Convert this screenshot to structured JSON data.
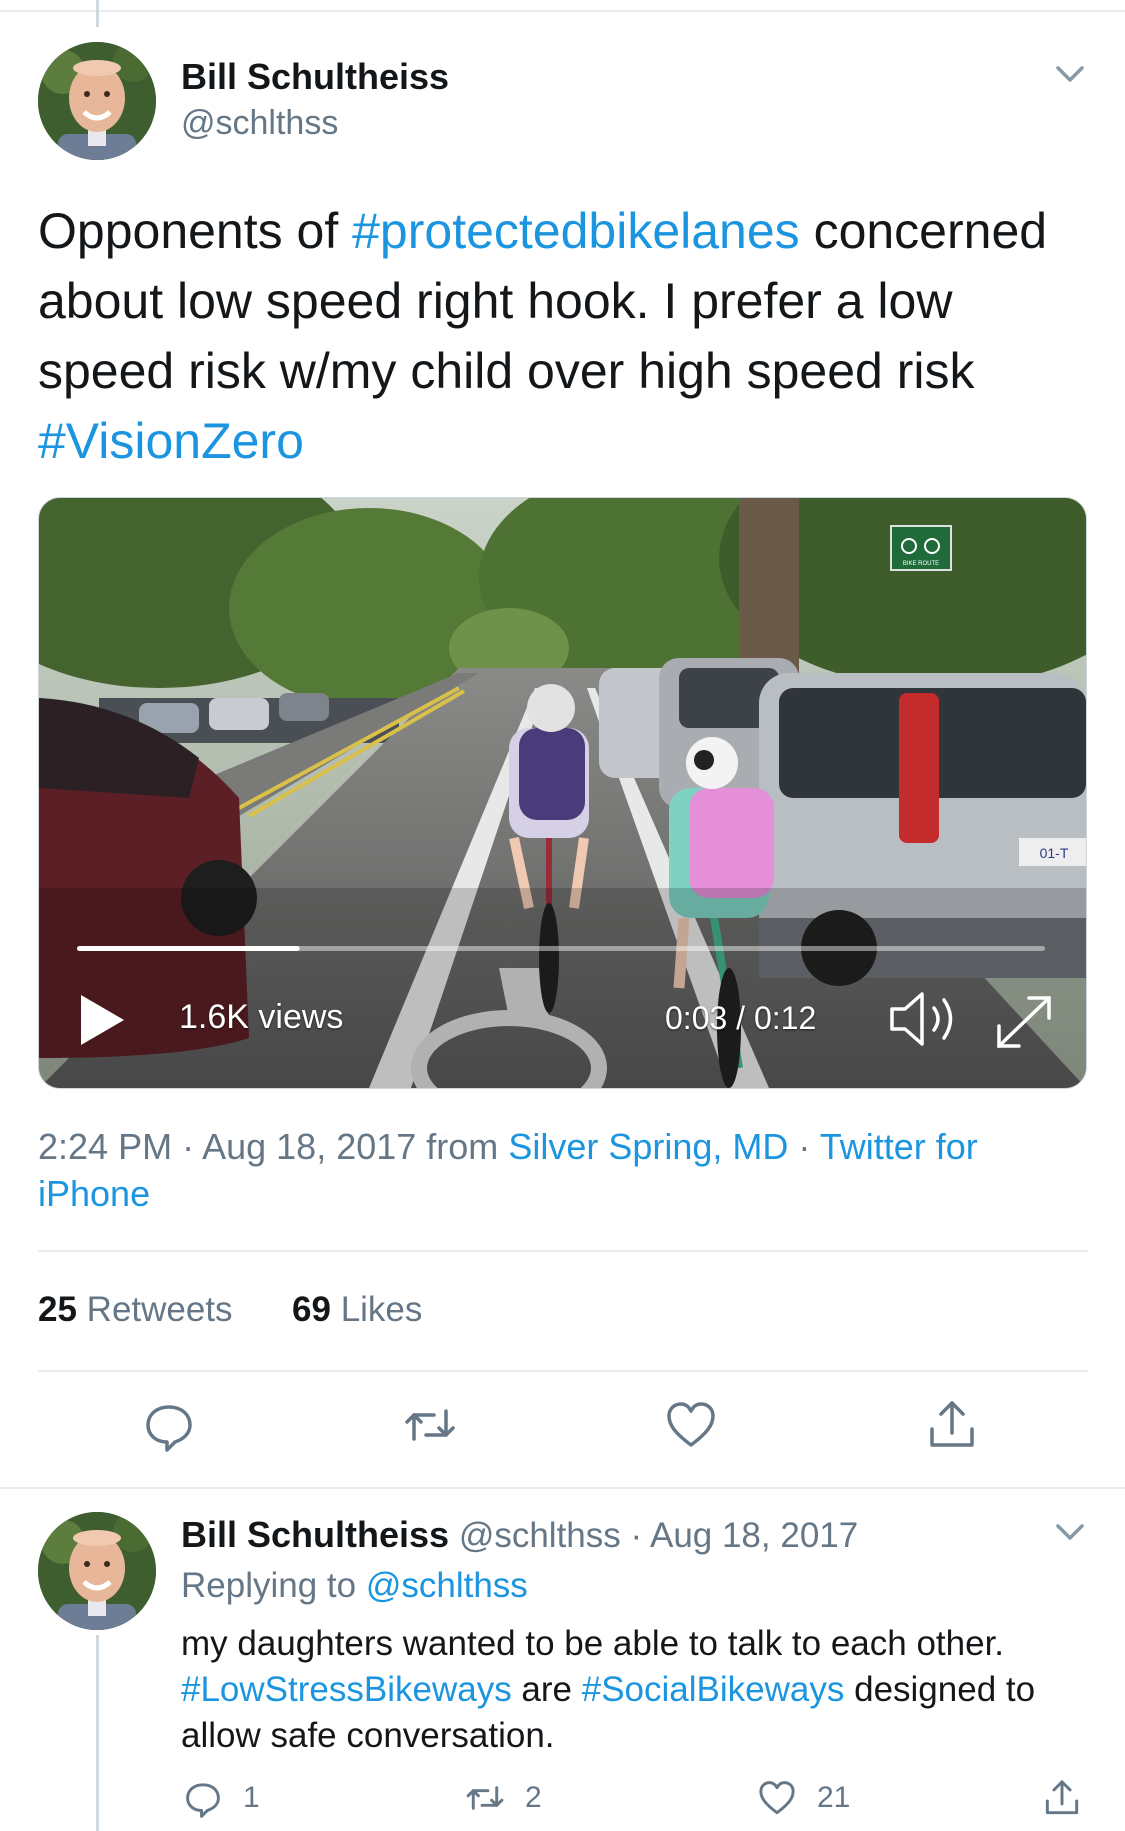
{
  "tweet": {
    "author_name": "Bill Schultheiss",
    "author_handle": "@schlthss",
    "text_parts": [
      {
        "text": "Opponents of ",
        "tag": false
      },
      {
        "text": "#protectedbikelanes",
        "tag": true
      },
      {
        "text": " concerned about low speed right hook. I prefer a low speed risk w/my child over high speed risk ",
        "tag": false
      },
      {
        "text": "#VisionZero",
        "tag": true
      }
    ],
    "video": {
      "views": "1.6K views",
      "time": "0:03 / 0:12",
      "progress": 0.23,
      "sign_text": "BIKE ROUTE",
      "plate_text": "01-T"
    },
    "meta": {
      "time": "2:24 PM",
      "sep": " · ",
      "date": "Aug 18, 2017",
      "from_label": " from ",
      "location": "Silver Spring, MD",
      "source": "Twitter for iPhone"
    },
    "retweets_count": "25",
    "retweets_label": " Retweets",
    "likes_count": "69",
    "likes_label": " Likes"
  },
  "reply": {
    "author_name": "Bill Schultheiss",
    "author_handle": "@schlthss",
    "sep": " · ",
    "date": "Aug 18, 2017",
    "replying_label": "Replying to ",
    "replying_handle": "@schlthss",
    "text_parts": [
      {
        "text": "my daughters wanted to be able to talk to each other. ",
        "tag": false
      },
      {
        "text": "#LowStressBikeways",
        "tag": true
      },
      {
        "text": " are ",
        "tag": false
      },
      {
        "text": "#SocialBikeways",
        "tag": true
      },
      {
        "text": " designed to allow safe conversation.",
        "tag": false
      }
    ],
    "reply_count": "1",
    "retweet_count": "2",
    "like_count": "21"
  },
  "colors": {
    "link": "#1b95e0",
    "secondary": "#657786",
    "divider": "#e6ecf0"
  },
  "icons": [
    "chevron-down-icon",
    "reply-icon",
    "retweet-icon",
    "like-icon",
    "share-icon",
    "play-icon",
    "volume-icon",
    "fullscreen-icon"
  ]
}
